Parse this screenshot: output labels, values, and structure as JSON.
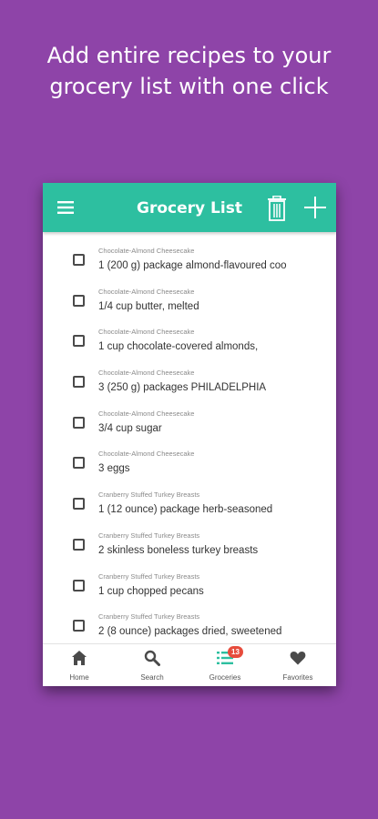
{
  "headline": {
    "line1": "Add entire recipes to your",
    "line2": "grocery list with one click"
  },
  "appbar": {
    "title": "Grocery List"
  },
  "items": [
    {
      "recipe": "Chocolate-Almond Cheesecake",
      "ingredient": "1 (200 g) package almond-flavoured coo"
    },
    {
      "recipe": "Chocolate-Almond Cheesecake",
      "ingredient": "1/4 cup butter, melted"
    },
    {
      "recipe": "Chocolate-Almond Cheesecake",
      "ingredient": "1 cup chocolate-covered almonds,"
    },
    {
      "recipe": "Chocolate-Almond Cheesecake",
      "ingredient": "3 (250 g) packages PHILADELPHIA"
    },
    {
      "recipe": "Chocolate-Almond Cheesecake",
      "ingredient": "3/4 cup sugar"
    },
    {
      "recipe": "Chocolate-Almond Cheesecake",
      "ingredient": "3 eggs"
    },
    {
      "recipe": "Cranberry Stuffed Turkey Breasts",
      "ingredient": "1 (12 ounce) package herb-seasoned"
    },
    {
      "recipe": "Cranberry Stuffed Turkey Breasts",
      "ingredient": "2 skinless boneless turkey breasts"
    },
    {
      "recipe": "Cranberry Stuffed Turkey Breasts",
      "ingredient": "1 cup chopped pecans"
    },
    {
      "recipe": "Cranberry Stuffed Turkey Breasts",
      "ingredient": "2 (8 ounce) packages dried, sweetened"
    }
  ],
  "nav": {
    "home": "Home",
    "search": "Search",
    "groceries": "Groceries",
    "groceries_badge": "13",
    "favorites": "Favorites"
  },
  "colors": {
    "background": "#8e44a8",
    "appbar": "#2dbfa0",
    "accent": "#2dbfa0",
    "badge": "#e74c3c"
  },
  "icons": {
    "menu": "hamburger-menu-icon",
    "trash": "trash-icon",
    "add": "plus-icon",
    "home": "home-icon",
    "search": "search-icon",
    "groceries": "list-icon",
    "favorites": "heart-icon"
  }
}
